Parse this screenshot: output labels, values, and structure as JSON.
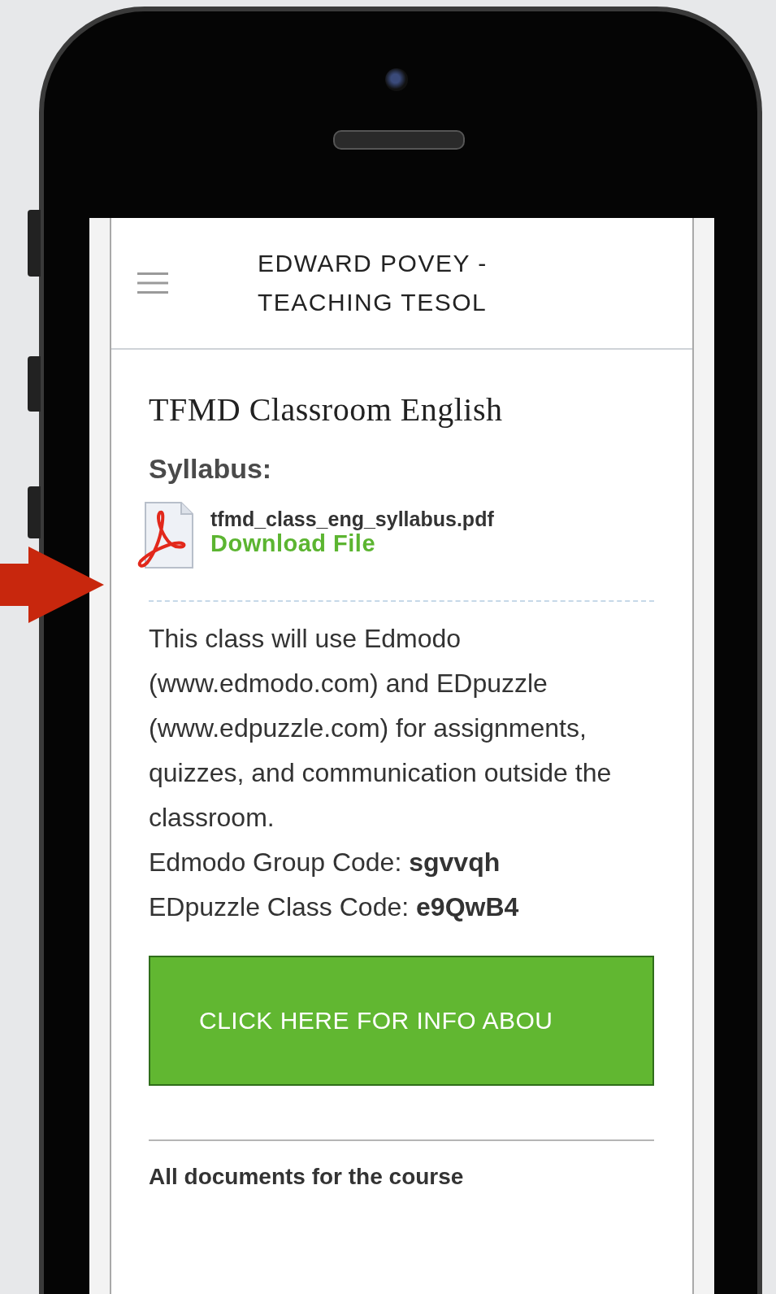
{
  "header": {
    "title": "EDWARD POVEY - TEACHING TESOL"
  },
  "page": {
    "title": "TFMD Classroom English",
    "section_heading": "Syllabus:",
    "file": {
      "name": "tfmd_class_eng_syllabus.pdf",
      "link": "Download File"
    },
    "paragraph": "This class will use Edmodo (www.edmodo.com) and EDpuzzle (www.edpuzzle.com) for assignments, quizzes, and communication outside the classroom.",
    "code_lines": [
      "Edmodo Group Code: **sgvvqh**",
      "EDpuzzle Class Code: **e9QwB4**"
    ],
    "button": "CLICK HERE FOR INFO ABOU",
    "footer_text": "All documents for the course"
  }
}
